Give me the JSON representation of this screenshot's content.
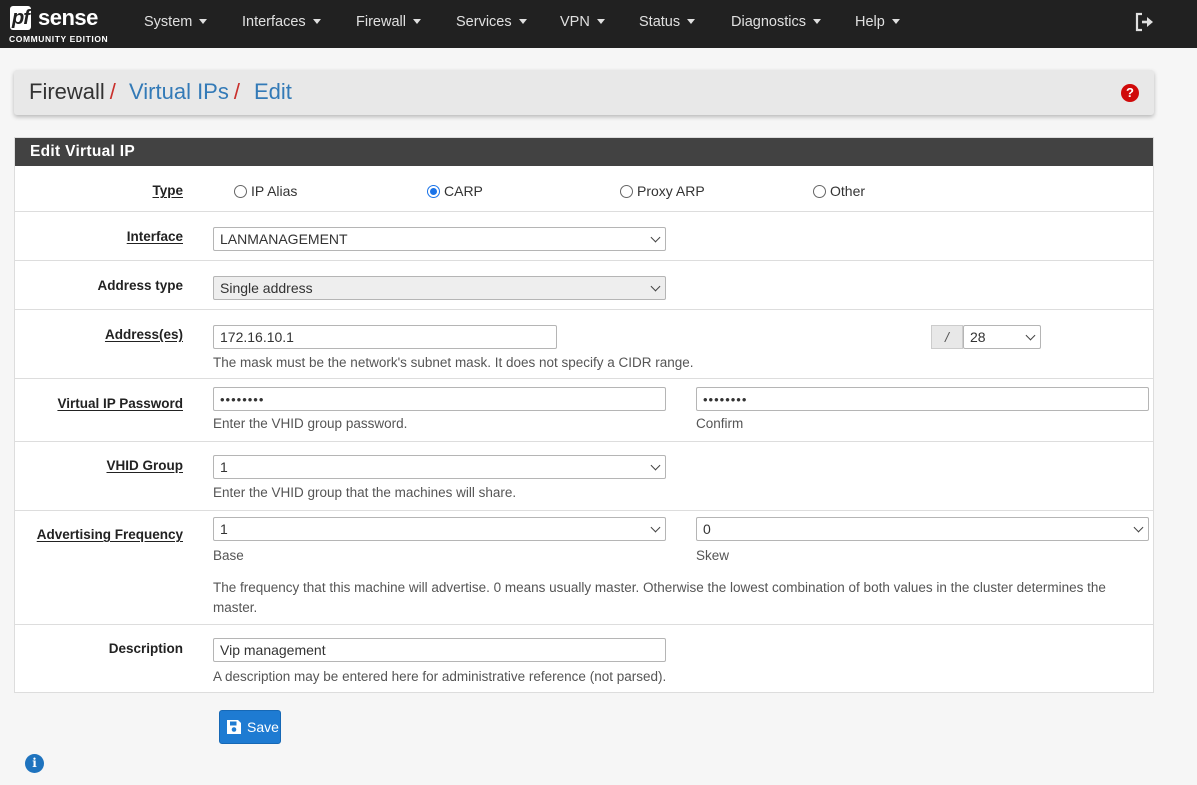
{
  "brand": {
    "name_part1": "pf",
    "name_part2": "sense",
    "edition": "COMMUNITY EDITION"
  },
  "nav": {
    "items": [
      {
        "label": "System"
      },
      {
        "label": "Interfaces"
      },
      {
        "label": "Firewall"
      },
      {
        "label": "Services"
      },
      {
        "label": "VPN"
      },
      {
        "label": "Status"
      },
      {
        "label": "Diagnostics"
      },
      {
        "label": "Help"
      }
    ],
    "logout_icon": "sign-out-icon"
  },
  "breadcrumb": {
    "items": [
      "Firewall",
      "Virtual IPs",
      "Edit"
    ],
    "separator": "/"
  },
  "panel": {
    "title": "Edit Virtual IP"
  },
  "form": {
    "type": {
      "label": "Type",
      "options": [
        "IP Alias",
        "CARP",
        "Proxy ARP",
        "Other"
      ],
      "selected": "CARP"
    },
    "interface": {
      "label": "Interface",
      "value": "LANMANAGEMENT"
    },
    "address_type": {
      "label": "Address type",
      "value": "Single address"
    },
    "address": {
      "label": "Address(es)",
      "value": "172.16.10.1",
      "slash": "/",
      "mask": "28",
      "help": "The mask must be the network's subnet mask. It does not specify a CIDR range."
    },
    "password": {
      "label": "Virtual IP Password",
      "value": "••••••••",
      "confirm_value": "••••••••",
      "help": "Enter the VHID group password.",
      "confirm_help": "Confirm"
    },
    "vhid": {
      "label": "VHID Group",
      "value": "1",
      "help": "Enter the VHID group that the machines will share."
    },
    "adv_freq": {
      "label": "Advertising Frequency",
      "base_value": "1",
      "skew_value": "0",
      "base_help": "Base",
      "skew_help": "Skew",
      "help": "The frequency that this machine will advertise. 0 means usually master. Otherwise the lowest combination of both values in the cluster determines the master."
    },
    "description": {
      "label": "Description",
      "value": "Vip management",
      "help": "A description may be entered here for administrative reference (not parsed)."
    }
  },
  "save_label": "Save",
  "colors": {
    "navbar": "#212121",
    "panel_heading": "#424242",
    "link": "#337ab7",
    "separator": "#c9302c",
    "primary_button": "#1e7bd2",
    "help_icon": "#d00a0a",
    "info_icon": "#1e73be"
  }
}
